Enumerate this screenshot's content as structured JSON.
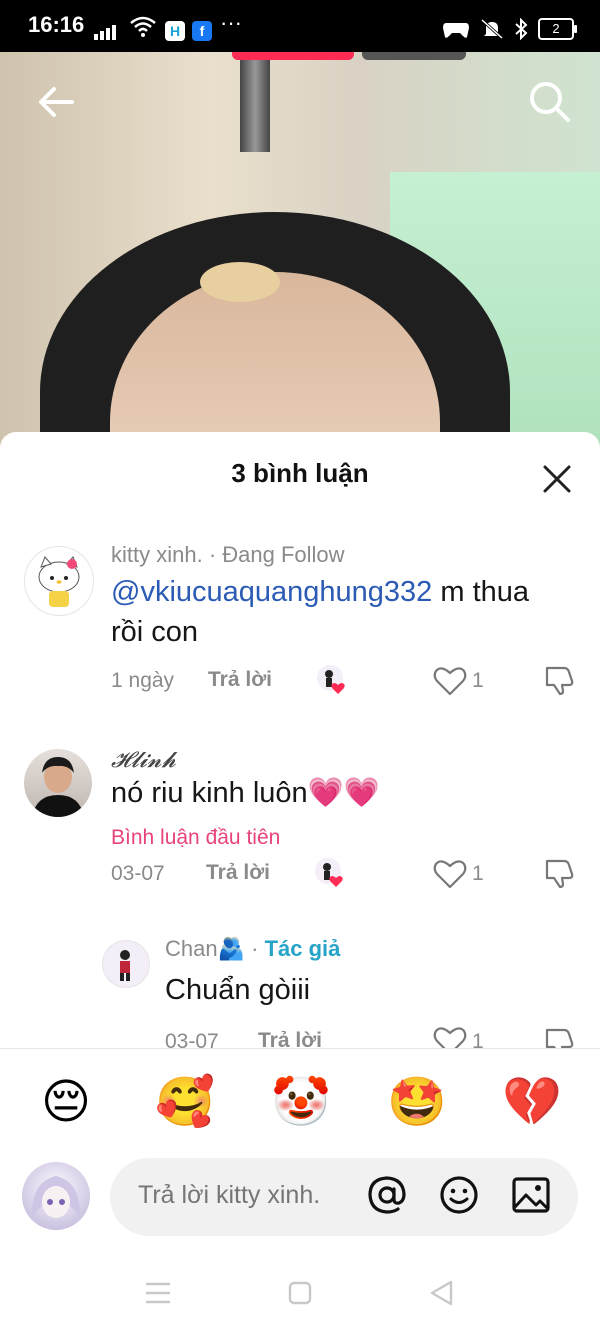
{
  "status_bar": {
    "time": "16:16",
    "app_icon_1": "H",
    "app_icon_2": "f",
    "more": "···",
    "battery": "2"
  },
  "header": {
    "back_icon": "arrow-left-icon",
    "search_icon": "search-icon"
  },
  "comments_panel": {
    "title": "3 bình luận",
    "comments": [
      {
        "username": "kitty xinh.",
        "status": " · Đang Follow",
        "mention": "@vkiucuaquanghung332",
        "text_after_mention": " m thua",
        "text_line2": "rồi con",
        "date": "1 ngày",
        "reply_label": "Trả lời",
        "likes": "1"
      },
      {
        "username": "𝓗𝓵𝓲𝓷𝓱",
        "text": "nó riu kinh luôn💗💗",
        "tag": "Bình luận đầu tiên",
        "date": "03-07",
        "reply_label": "Trả lời",
        "likes": "1"
      },
      {
        "username": "Chan🫂",
        "author_sep": " · ",
        "author_tag": "Tác giả",
        "text": "Chuẩn gòiii",
        "date": "03-07",
        "reply_label": "Trả lời",
        "likes": "1"
      }
    ]
  },
  "emoji_bar": [
    "😔",
    "🥰",
    "🤡",
    "🤩",
    "💔"
  ],
  "input": {
    "placeholder": "Trả lời kitty xinh.",
    "mention_icon": "at-icon",
    "emoji_icon": "smiley-icon",
    "image_icon": "image-icon"
  },
  "colors": {
    "accent_pink": "#fe2c55",
    "mention_blue": "#2b5bb4",
    "first_comment_pink": "#e8437d",
    "author_cyan": "#26a3c7"
  }
}
